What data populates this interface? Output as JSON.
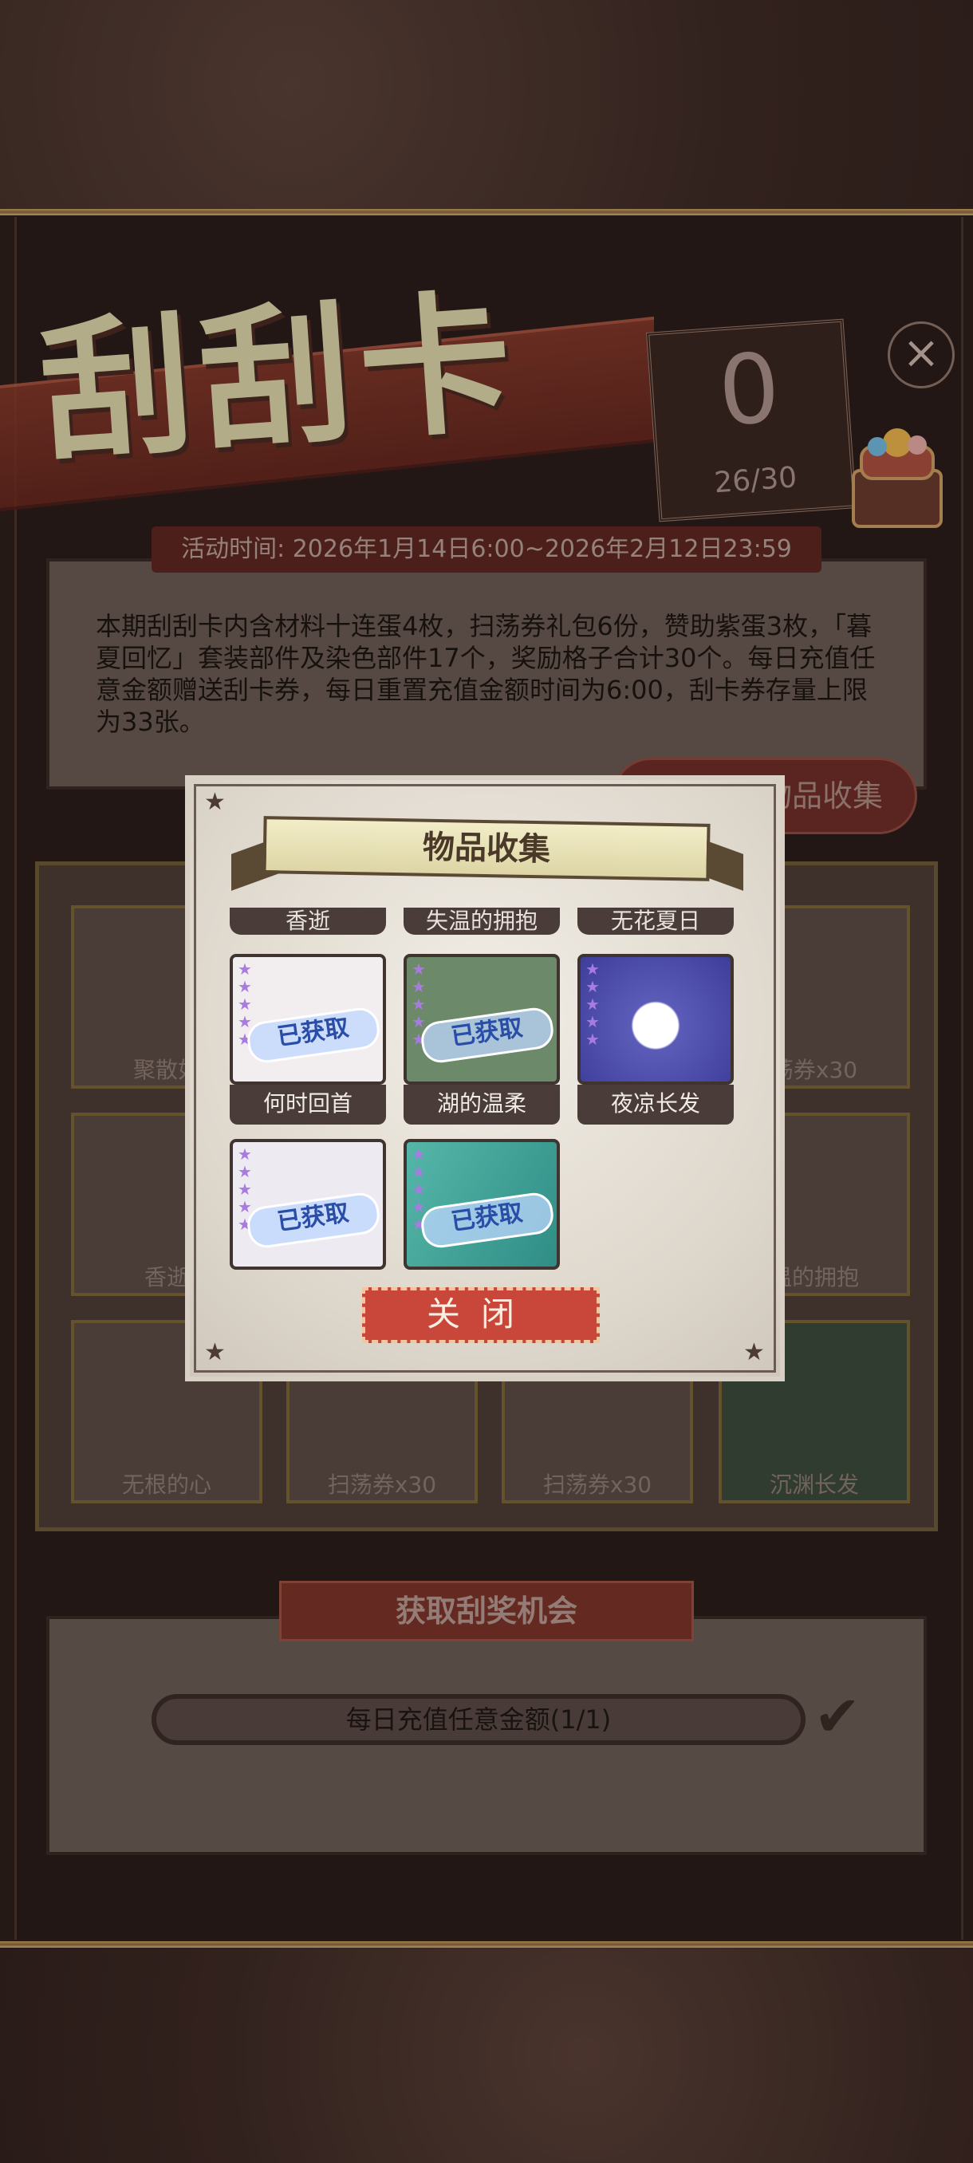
{
  "header": {
    "title": "刮刮卡",
    "counter_value": "0",
    "counter_fraction": "26/30",
    "close_symbol": "×"
  },
  "event": {
    "time": "活动时间: 2026年1月14日6:00~2026年2月12日23:59",
    "description": "本期刮刮卡内含材料十连蛋4枚，扫荡券礼包6份，赞助紫蛋3枚，「暮夏回忆」套装部件及染色部件17个，奖励格子合计30个。每日充值任意金额赠送刮卡券，每日重置充值金额时间为6:00，刮卡券存量上限为33张。"
  },
  "collect_button": "物品收集",
  "background_grid": {
    "labels": [
      "聚散如",
      "荡券x30",
      "香逝",
      "温的拥抱",
      "无根的心",
      "扫荡券x30",
      "扫荡券x30",
      "沉渊长发"
    ]
  },
  "modal": {
    "title": "物品收集",
    "top_row_names": [
      "香逝",
      "失温的拥抱",
      "无花夏日"
    ],
    "items": [
      {
        "name": "何时回首",
        "status": "已获取",
        "color": "#f2eef0"
      },
      {
        "name": "湖的温柔",
        "status": "已获取",
        "color": "#6c8a6a"
      },
      {
        "name": "夜凉长发",
        "status": "",
        "color": "#5b5bb8"
      },
      {
        "name": "",
        "status": "已获取",
        "color": "#eeeaf2"
      },
      {
        "name": "",
        "status": "已获取",
        "color": "#55b7a8"
      }
    ],
    "close_button": "关闭",
    "star_symbol": "★"
  },
  "opportunity": {
    "title": "获取刮奖机会",
    "task": "每日充值任意金额(1/1)",
    "check_symbol": "✔"
  }
}
